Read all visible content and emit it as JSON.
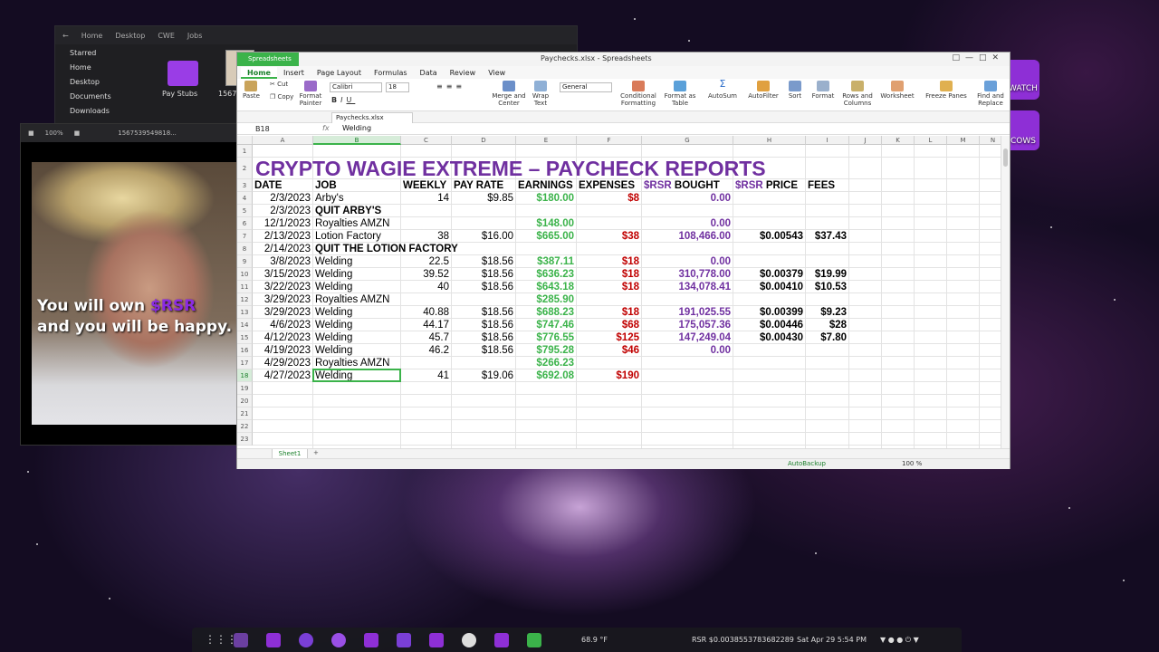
{
  "desktop": {
    "icons": [
      {
        "label": "WATCH"
      },
      {
        "label": "COWS"
      }
    ]
  },
  "file_manager": {
    "nav": [
      "Home",
      "Desktop",
      "CWE",
      "Jobs"
    ],
    "sidebar": [
      "Starred",
      "Home",
      "Desktop",
      "Documents",
      "Downloads"
    ],
    "items": [
      {
        "label": "Pay Stubs"
      },
      {
        "label": "15675"
      }
    ]
  },
  "image_viewer": {
    "zoom": "100%",
    "filename": "1567539549818...",
    "caption_line1": "You will own ",
    "caption_rsr": "$RSR",
    "caption_line2": "and you will be happy."
  },
  "spreadsheet": {
    "app_name": "Spreadsheets",
    "window_title": "Paychecks.xlsx - Spreadsheets",
    "menu": [
      "Home",
      "Insert",
      "Page Layout",
      "Formulas",
      "Data",
      "Review",
      "View"
    ],
    "ribbon": {
      "paste": "Paste",
      "cut": "Cut",
      "copy": "Copy",
      "format_painter": "Format Painter",
      "font_name": "Calibri",
      "font_size": "18",
      "merge_center": "Merge and Center",
      "wrap_text": "Wrap Text",
      "number_format": "General",
      "conditional_formatting": "Conditional Formatting",
      "format_as_table": "Format as Table",
      "autosum": "AutoSum",
      "autofilter": "AutoFilter",
      "sort": "Sort",
      "format": "Format",
      "rows_columns": "Rows and Columns",
      "worksheet": "Worksheet",
      "freeze_panes": "Freeze Panes",
      "find_replace": "Find and Replace"
    },
    "doc_tab": "Paychecks.xlsx",
    "name_box": "B18",
    "fx": "fx",
    "formula_value": "Welding",
    "columns": [
      "A",
      "B",
      "C",
      "D",
      "E",
      "F",
      "G",
      "H",
      "I",
      "J",
      "K",
      "L",
      "M",
      "N"
    ],
    "title": "CRYPTO WAGIE EXTREME – PAYCHECK REPORTS",
    "headers": {
      "date": "DATE",
      "job": "JOB",
      "weekly": "WEEKLY",
      "pay_rate": "PAY RATE",
      "earnings": "EARNINGS",
      "expenses": "EXPENSES",
      "rsr_bought": "$RSR BOUGHT",
      "rsr_price": "$RSR PRICE",
      "fees": "FEES"
    },
    "rows": [
      {
        "row": "4",
        "date": "2/3/2023",
        "job": "Arby's",
        "job_bold": false,
        "weekly": "14",
        "pay_rate": "$9.85",
        "earnings": "$180.00",
        "expenses": "$8",
        "rsr_bought": "0.00",
        "rsr_price": "",
        "fees": ""
      },
      {
        "row": "5",
        "date": "2/3/2023",
        "job": "QUIT ARBY'S",
        "job_bold": true,
        "weekly": "",
        "pay_rate": "",
        "earnings": "",
        "expenses": "",
        "rsr_bought": "",
        "rsr_price": "",
        "fees": ""
      },
      {
        "row": "6",
        "date": "12/1/2023",
        "job": "Royalties AMZN",
        "job_bold": false,
        "weekly": "",
        "pay_rate": "",
        "earnings": "$148.00",
        "expenses": "",
        "rsr_bought": "0.00",
        "rsr_price": "",
        "fees": ""
      },
      {
        "row": "7",
        "date": "2/13/2023",
        "job": "Lotion Factory",
        "job_bold": false,
        "weekly": "38",
        "pay_rate": "$16.00",
        "earnings": "$665.00",
        "expenses": "$38",
        "rsr_bought": "108,466.00",
        "rsr_price": "$0.00543",
        "fees": "$37.43"
      },
      {
        "row": "8",
        "date": "2/14/2023",
        "job": "QUIT THE LOTION FACTORY",
        "job_bold": true,
        "weekly": "",
        "pay_rate": "",
        "earnings": "",
        "expenses": "",
        "rsr_bought": "",
        "rsr_price": "",
        "fees": ""
      },
      {
        "row": "9",
        "date": "3/8/2023",
        "job": "Welding",
        "job_bold": false,
        "weekly": "22.5",
        "pay_rate": "$18.56",
        "earnings": "$387.11",
        "expenses": "$18",
        "rsr_bought": "0.00",
        "rsr_price": "",
        "fees": ""
      },
      {
        "row": "10",
        "date": "3/15/2023",
        "job": "Welding",
        "job_bold": false,
        "weekly": "39.52",
        "pay_rate": "$18.56",
        "earnings": "$636.23",
        "expenses": "$18",
        "rsr_bought": "310,778.00",
        "rsr_price": "$0.00379",
        "fees": "$19.99"
      },
      {
        "row": "11",
        "date": "3/22/2023",
        "job": "Welding",
        "job_bold": false,
        "weekly": "40",
        "pay_rate": "$18.56",
        "earnings": "$643.18",
        "expenses": "$18",
        "rsr_bought": "134,078.41",
        "rsr_price": "$0.00410",
        "fees": "$10.53"
      },
      {
        "row": "12",
        "date": "3/29/2023",
        "job": "Royalties AMZN",
        "job_bold": false,
        "weekly": "",
        "pay_rate": "",
        "earnings": "$285.90",
        "expenses": "",
        "rsr_bought": "",
        "rsr_price": "",
        "fees": ""
      },
      {
        "row": "13",
        "date": "3/29/2023",
        "job": "Welding",
        "job_bold": false,
        "weekly": "40.88",
        "pay_rate": "$18.56",
        "earnings": "$688.23",
        "expenses": "$18",
        "rsr_bought": "191,025.55",
        "rsr_price": "$0.00399",
        "fees": "$9.23"
      },
      {
        "row": "14",
        "date": "4/6/2023",
        "job": "Welding",
        "job_bold": false,
        "weekly": "44.17",
        "pay_rate": "$18.56",
        "earnings": "$747.46",
        "expenses": "$68",
        "rsr_bought": "175,057.36",
        "rsr_price": "$0.00446",
        "fees": "$28"
      },
      {
        "row": "15",
        "date": "4/12/2023",
        "job": "Welding",
        "job_bold": false,
        "weekly": "45.7",
        "pay_rate": "$18.56",
        "earnings": "$776.55",
        "expenses": "$125",
        "rsr_bought": "147,249.04",
        "rsr_price": "$0.00430",
        "fees": "$7.80"
      },
      {
        "row": "16",
        "date": "4/19/2023",
        "job": "Welding",
        "job_bold": false,
        "weekly": "46.2",
        "pay_rate": "$18.56",
        "earnings": "$795.28",
        "expenses": "$46",
        "rsr_bought": "0.00",
        "rsr_price": "",
        "fees": ""
      },
      {
        "row": "17",
        "date": "4/29/2023",
        "job": "Royalties AMZN",
        "job_bold": false,
        "weekly": "",
        "pay_rate": "",
        "earnings": "$266.23",
        "expenses": "",
        "rsr_bought": "",
        "rsr_price": "",
        "fees": ""
      },
      {
        "row": "18",
        "date": "4/27/2023",
        "job": "Welding",
        "job_bold": false,
        "weekly": "41",
        "pay_rate": "$19.06",
        "earnings": "$692.08",
        "expenses": "$190",
        "rsr_bought": "",
        "rsr_price": "",
        "fees": ""
      }
    ],
    "empty_rows": [
      "19",
      "20",
      "21",
      "22",
      "23"
    ],
    "sheet_tab": "Sheet1",
    "status": {
      "autobackup": "AutoBackup",
      "zoom": "100 %"
    }
  },
  "taskbar": {
    "weather": "68.9 °F",
    "ticker": "RSR $0.0038553783682289",
    "datetime": "Sat Apr 29  5:54 PM"
  }
}
